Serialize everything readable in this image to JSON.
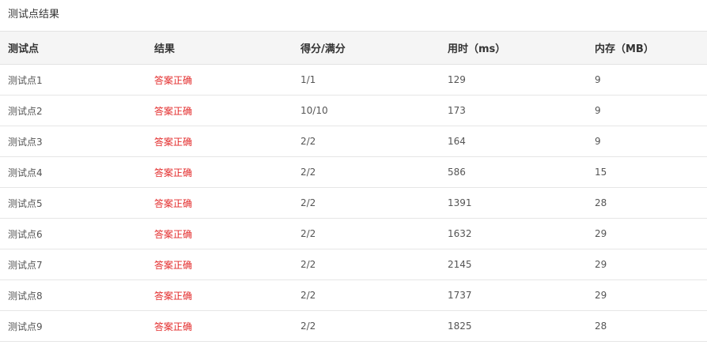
{
  "section_title": "测试点结果",
  "colors": {
    "accepted": "#e32b2b",
    "header_bg": "#f5f5f5"
  },
  "columns": [
    "测试点",
    "结果",
    "得分/满分",
    "用时（ms）",
    "内存（MB）"
  ],
  "rows": [
    {
      "case": "测试点1",
      "result": "答案正确",
      "score": "1/1",
      "time": "129",
      "memory": "9"
    },
    {
      "case": "测试点2",
      "result": "答案正确",
      "score": "10/10",
      "time": "173",
      "memory": "9"
    },
    {
      "case": "测试点3",
      "result": "答案正确",
      "score": "2/2",
      "time": "164",
      "memory": "9"
    },
    {
      "case": "测试点4",
      "result": "答案正确",
      "score": "2/2",
      "time": "586",
      "memory": "15"
    },
    {
      "case": "测试点5",
      "result": "答案正确",
      "score": "2/2",
      "time": "1391",
      "memory": "28"
    },
    {
      "case": "测试点6",
      "result": "答案正确",
      "score": "2/2",
      "time": "1632",
      "memory": "29"
    },
    {
      "case": "测试点7",
      "result": "答案正确",
      "score": "2/2",
      "time": "2145",
      "memory": "29"
    },
    {
      "case": "测试点8",
      "result": "答案正确",
      "score": "2/2",
      "time": "1737",
      "memory": "29"
    },
    {
      "case": "测试点9",
      "result": "答案正确",
      "score": "2/2",
      "time": "1825",
      "memory": "28"
    }
  ]
}
